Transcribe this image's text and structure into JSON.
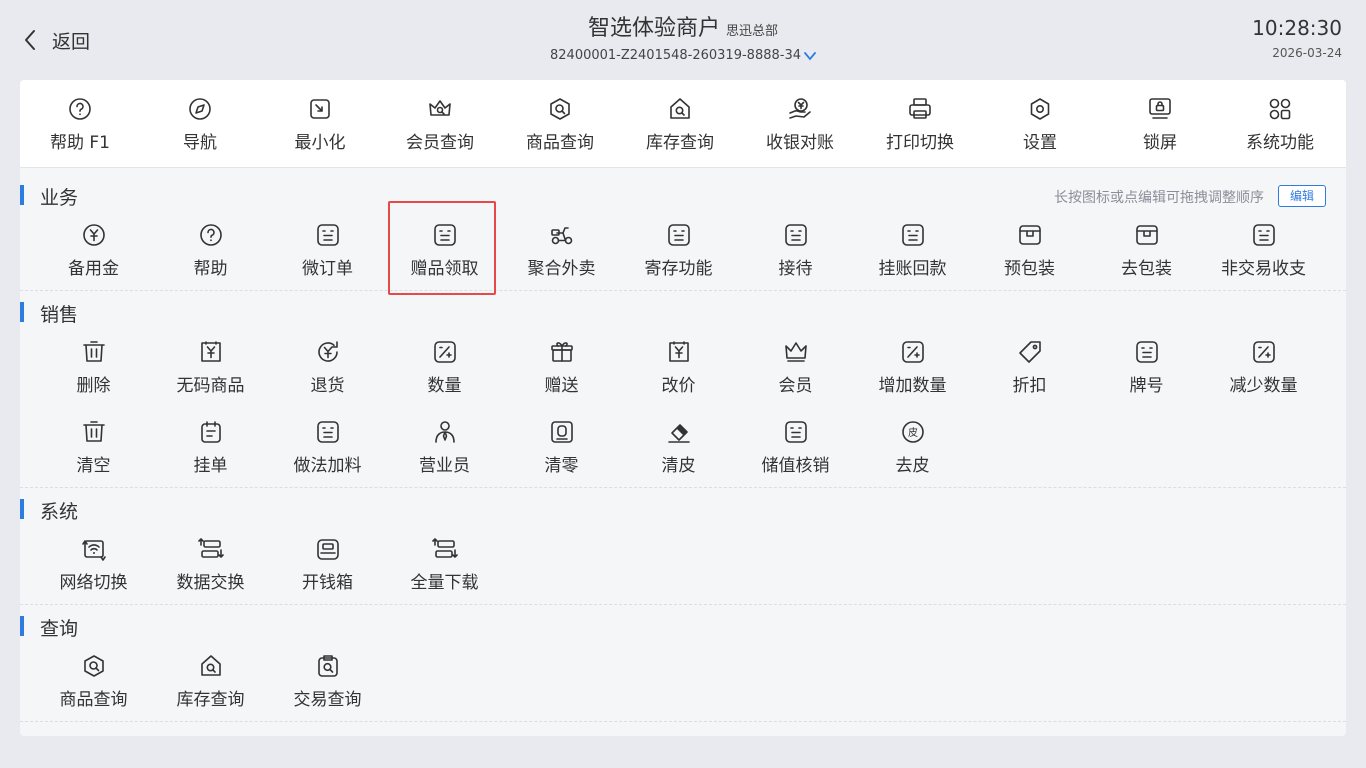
{
  "header": {
    "back_label": "返回",
    "title": "智选体验商户",
    "subtitle": "思迅总部",
    "device_id": "82400001-Z2401548-260319-8888-34",
    "time": "10:28:30",
    "date": "2026-03-24"
  },
  "toolbar": [
    {
      "label": "帮助 F1",
      "icon": "help-icon"
    },
    {
      "label": "导航",
      "icon": "compass-icon"
    },
    {
      "label": "最小化",
      "icon": "minimize-icon"
    },
    {
      "label": "会员查询",
      "icon": "crown-search-icon"
    },
    {
      "label": "商品查询",
      "icon": "hex-search-icon"
    },
    {
      "label": "库存查询",
      "icon": "house-search-icon"
    },
    {
      "label": "收银对账",
      "icon": "yen-hand-icon"
    },
    {
      "label": "打印切换",
      "icon": "printer-icon"
    },
    {
      "label": "设置",
      "icon": "gear-icon"
    },
    {
      "label": "锁屏",
      "icon": "lock-screen-icon"
    },
    {
      "label": "系统功能",
      "icon": "grid-icon"
    }
  ],
  "sections": {
    "business": {
      "title": "业务",
      "hint": "长按图标或点编辑可拖拽调整顺序",
      "edit_label": "编辑",
      "items": [
        {
          "label": "备用金",
          "icon": "yen-circle-icon"
        },
        {
          "label": "帮助",
          "icon": "help-icon"
        },
        {
          "label": "微订单",
          "icon": "face-icon"
        },
        {
          "label": "赠品领取",
          "icon": "face-icon"
        },
        {
          "label": "聚合外卖",
          "icon": "scooter-icon"
        },
        {
          "label": "寄存功能",
          "icon": "face-icon"
        },
        {
          "label": "接待",
          "icon": "face-icon"
        },
        {
          "label": "挂账回款",
          "icon": "face-icon"
        },
        {
          "label": "预包装",
          "icon": "package-icon"
        },
        {
          "label": "去包装",
          "icon": "package-icon"
        },
        {
          "label": "非交易收支",
          "icon": "face-icon"
        }
      ]
    },
    "sales": {
      "title": "销售",
      "items": [
        {
          "label": "删除",
          "icon": "trash-icon"
        },
        {
          "label": "无码商品",
          "icon": "yen-bag-icon"
        },
        {
          "label": "退货",
          "icon": "yen-refresh-icon"
        },
        {
          "label": "数量",
          "icon": "percent-plus-icon"
        },
        {
          "label": "赠送",
          "icon": "gift-icon"
        },
        {
          "label": "改价",
          "icon": "yen-bag-icon"
        },
        {
          "label": "会员",
          "icon": "crown-icon"
        },
        {
          "label": "增加数量",
          "icon": "percent-plus-icon"
        },
        {
          "label": "折扣",
          "icon": "tag-icon"
        },
        {
          "label": "牌号",
          "icon": "face-icon"
        },
        {
          "label": "减少数量",
          "icon": "percent-plus-icon"
        },
        {
          "label": "清空",
          "icon": "trash-icon"
        },
        {
          "label": "挂单",
          "icon": "clipboard-icon"
        },
        {
          "label": "做法加料",
          "icon": "face-icon"
        },
        {
          "label": "营业员",
          "icon": "person-icon"
        },
        {
          "label": "清零",
          "icon": "zero-icon"
        },
        {
          "label": "清皮",
          "icon": "eraser-icon"
        },
        {
          "label": "储值核销",
          "icon": "face-icon"
        },
        {
          "label": "去皮",
          "icon": "pi-circle-icon"
        }
      ]
    },
    "system": {
      "title": "系统",
      "items": [
        {
          "label": "网络切换",
          "icon": "wifi-switch-icon"
        },
        {
          "label": "数据交换",
          "icon": "data-exchange-icon"
        },
        {
          "label": "开钱箱",
          "icon": "cash-drawer-icon"
        },
        {
          "label": "全量下载",
          "icon": "data-exchange-icon"
        }
      ]
    },
    "query": {
      "title": "查询",
      "items": [
        {
          "label": "商品查询",
          "icon": "hex-search-icon"
        },
        {
          "label": "库存查询",
          "icon": "house-search-icon"
        },
        {
          "label": "交易查询",
          "icon": "clipboard-search-icon"
        }
      ]
    }
  },
  "colors": {
    "accent": "#2f7ce0",
    "highlight": "#e74848",
    "background": "#e9eaef",
    "panel": "#f5f6f8"
  }
}
